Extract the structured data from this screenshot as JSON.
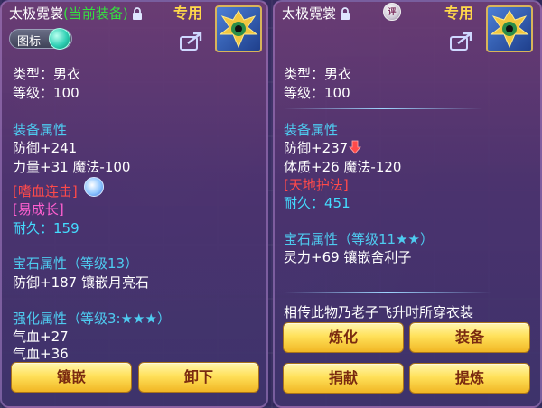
{
  "left": {
    "item_name": "太极霓裳",
    "equip_status": "(当前装备)",
    "exclusive_tag": "专用",
    "icon_toggle_label": "图标",
    "type": "类型：男衣",
    "level": "等级：100",
    "attr_header": "装备属性",
    "defense": "防御+241",
    "stats": "力量+31 魔法-100",
    "special_effect": "[嗜血连击]",
    "special_skill": "[易成长]",
    "durability": "耐久：159",
    "gem_header": "宝石属性（等级13）",
    "gem_stats": "防御+187 镶嵌月亮石",
    "enhance_header": "强化属性（等级3:★★★）",
    "enhance_1": "气血+27",
    "enhance_2": "气血+36",
    "btn_inlay": "镶嵌",
    "btn_unequip": "卸下"
  },
  "right": {
    "item_name": "太极霓裳",
    "badge": "评",
    "exclusive_tag": "专用",
    "type": "类型：男衣",
    "level": "等级：100",
    "attr_header": "装备属性",
    "defense": "防御+237",
    "stats": "体质+26 魔法-120",
    "special_effect": "[天地护法]",
    "durability": "耐久：451",
    "gem_header": "宝石属性（等级11★★）",
    "gem_stats": "灵力+69 镶嵌舍利子",
    "description": "相传此物乃老子飞升时所穿衣装",
    "btn_refine": "炼化",
    "btn_equip": "装备",
    "btn_donate": "捐献",
    "btn_extract": "提炼"
  },
  "colors": {
    "equipped_green": "#35e040",
    "header_cyan": "#4ecbf0",
    "stat_decrease_red": "#ff4a4a",
    "skill_pink": "#ff5fd0",
    "durability_cyan": "#44dcff",
    "exclusive_gold": "#ffd84a",
    "button_gold": "#ffe15a"
  },
  "icons": [
    "lock-icon",
    "share-icon",
    "down-arrow-icon",
    "spiral-icon",
    "toggle-knob"
  ]
}
